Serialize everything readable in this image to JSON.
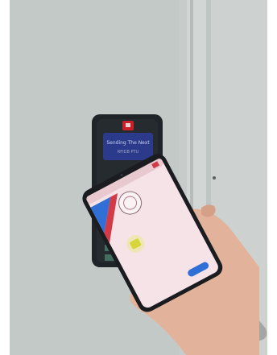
{
  "reader": {
    "brand_badge": "",
    "line1": "Sending The Next",
    "line2": "RFIDB PTU"
  },
  "phone_app": {
    "status_time": "",
    "title": "",
    "logo_text": "",
    "subtitle": "",
    "button_label": ""
  },
  "colors": {
    "wall": "#c6ccc9",
    "reader_body": "#1f2327",
    "reader_screen": "#2b3a8a",
    "reader_badge": "#c8202b",
    "phone_screen_bg": "#f6e3e7",
    "app_accent_blue": "#2f6fd6",
    "app_accent_red": "#d33a48",
    "app_badge_yellow": "#d6d63a",
    "skin": "#e2b39a"
  }
}
